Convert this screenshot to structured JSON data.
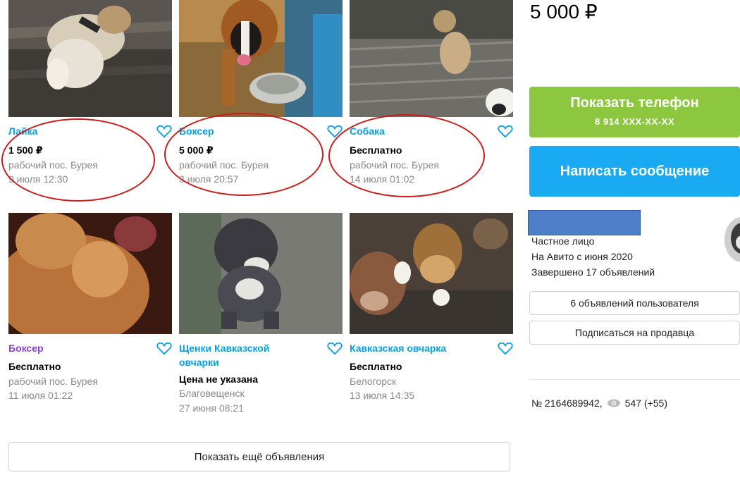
{
  "listings": [
    {
      "title": "Лайка",
      "price": "1 500 ₽",
      "location": "рабочий пос. Бурея",
      "date": "9 июля 12:30",
      "title_color": "#0a9de0"
    },
    {
      "title": "Боксер",
      "price": "5 000 ₽",
      "location": "рабочий пос. Бурея",
      "date": "3 июля 20:57",
      "title_color": "#0a9de0"
    },
    {
      "title": "Собака",
      "price": "Бесплатно",
      "location": "рабочий пос. Бурея",
      "date": "14 июля 01:02",
      "title_color": "#0a9de0"
    },
    {
      "title": "Боксер",
      "price": "Бесплатно",
      "location": "рабочий пос. Бурея",
      "date": "11 июля 01:22",
      "title_color": "#8a3fd1"
    },
    {
      "title": "Щенки Кавказской овчарки",
      "price": "Цена не указана",
      "location": "Благовещенск",
      "date": "27 июня 08:21",
      "title_color": "#0a9de0"
    },
    {
      "title": "Кавказская овчарка",
      "price": "Бесплатно",
      "location": "Белогорск",
      "date": "13 июля 14:35",
      "title_color": "#0a9de0"
    }
  ],
  "show_more_label": "Показать ещё объявления",
  "right": {
    "price": "5 000 ₽",
    "phone_button_label": "Показать телефон",
    "phone_number": "8 914 XXX-XX-XX",
    "message_button_label": "Написать сообщение",
    "seller_type": "Частное лицо",
    "seller_since": "На Авито с июня 2020",
    "seller_completed": "Завершено 17 объявлений",
    "user_ads_button": "6 объявлений пользователя",
    "subscribe_button": "Подписаться на продавца",
    "ad_number": "№ 2164689942,",
    "views": "547 (+55)"
  },
  "colors": {
    "phone_button": "#8dc63f",
    "message_button": "#1aaaf3",
    "link": "#0a9de0",
    "annotation": "#c81e1e"
  }
}
